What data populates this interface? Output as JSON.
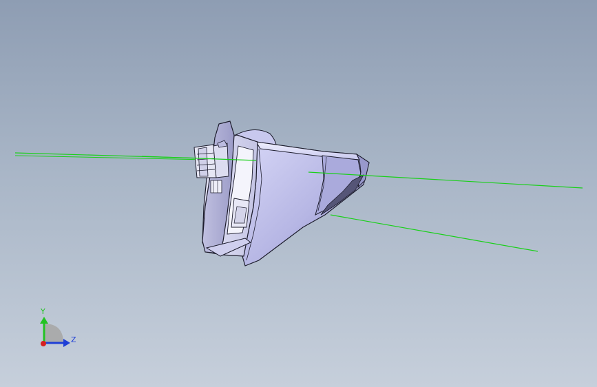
{
  "viewport": {
    "background_top": "#8e9db3",
    "background_bottom": "#c6cfdb"
  },
  "triad": {
    "y_label": "Y",
    "z_label": "Z",
    "y_color": "#22c322",
    "z_color": "#1f3fd6",
    "x_color": "#d62020"
  },
  "model": {
    "body_color": "#b8b8e6",
    "edge_color": "#1c1c2c",
    "guide_line_color": "#19d019"
  }
}
